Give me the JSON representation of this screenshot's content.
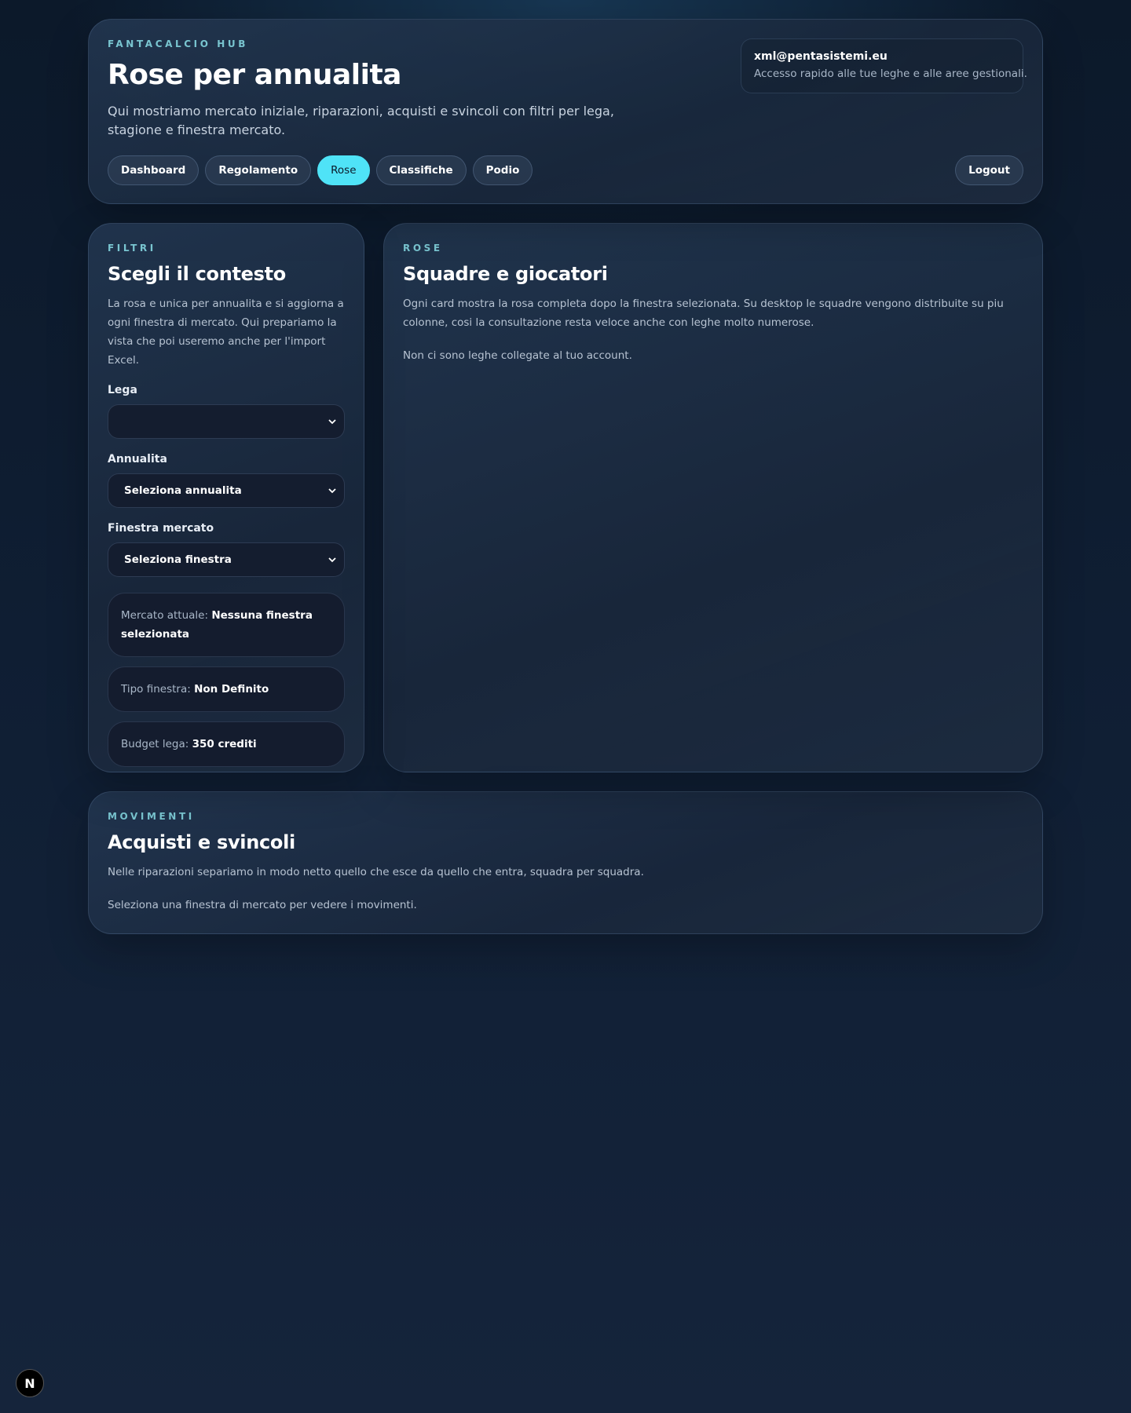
{
  "header": {
    "eyebrow": "FANTACALCIO HUB",
    "title": "Rose per annualita",
    "subtitle": "Qui mostriamo mercato iniziale, riparazioni, acquisti e svincoli con filtri per lega, stagione e finestra mercato."
  },
  "account": {
    "email": "xml@pentasistemi.eu",
    "description": "Accesso rapido alle tue leghe e alle aree gestionali."
  },
  "nav": {
    "items": [
      {
        "label": "Dashboard",
        "active": false
      },
      {
        "label": "Regolamento",
        "active": false
      },
      {
        "label": "Rose",
        "active": true
      },
      {
        "label": "Classifiche",
        "active": false
      },
      {
        "label": "Podio",
        "active": false
      }
    ],
    "logout_label": "Logout"
  },
  "filters": {
    "eyebrow": "FILTRI",
    "title": "Scegli il contesto",
    "description": "La rosa e unica per annualita e si aggiorna a ogni finestra di mercato. Qui prepariamo la vista che poi useremo anche per l'import Excel.",
    "lega": {
      "label": "Lega",
      "value": ""
    },
    "annualita": {
      "label": "Annualita",
      "value": "Seleziona annualita"
    },
    "finestra": {
      "label": "Finestra mercato",
      "value": "Seleziona finestra"
    },
    "mercato_attuale": {
      "key": "Mercato attuale:",
      "value": "Nessuna finestra selezionata"
    },
    "tipo_finestra": {
      "key": "Tipo finestra:",
      "value": "Non Definito"
    },
    "budget": {
      "key": "Budget lega:",
      "value": "350 crediti"
    }
  },
  "rose": {
    "eyebrow": "ROSE",
    "title": "Squadre e giocatori",
    "description": "Ogni card mostra la rosa completa dopo la finestra selezionata. Su desktop le squadre vengono distribuite su piu colonne, cosi la consultazione resta veloce anche con leghe molto numerose.",
    "empty": "Non ci sono leghe collegate al tuo account."
  },
  "movimenti": {
    "eyebrow": "MOVIMENTI",
    "title": "Acquisti e svincoli",
    "description": "Nelle riparazioni separiamo in modo netto quello che esce da quello che entra, squadra per squadra.",
    "empty": "Seleziona una finestra di mercato per vedere i movimenti."
  },
  "badge": {
    "letter": "N"
  },
  "colors": {
    "accent": "#4fe3f7",
    "eyebrow": "#79c5d0",
    "background": "#0f1e33"
  }
}
